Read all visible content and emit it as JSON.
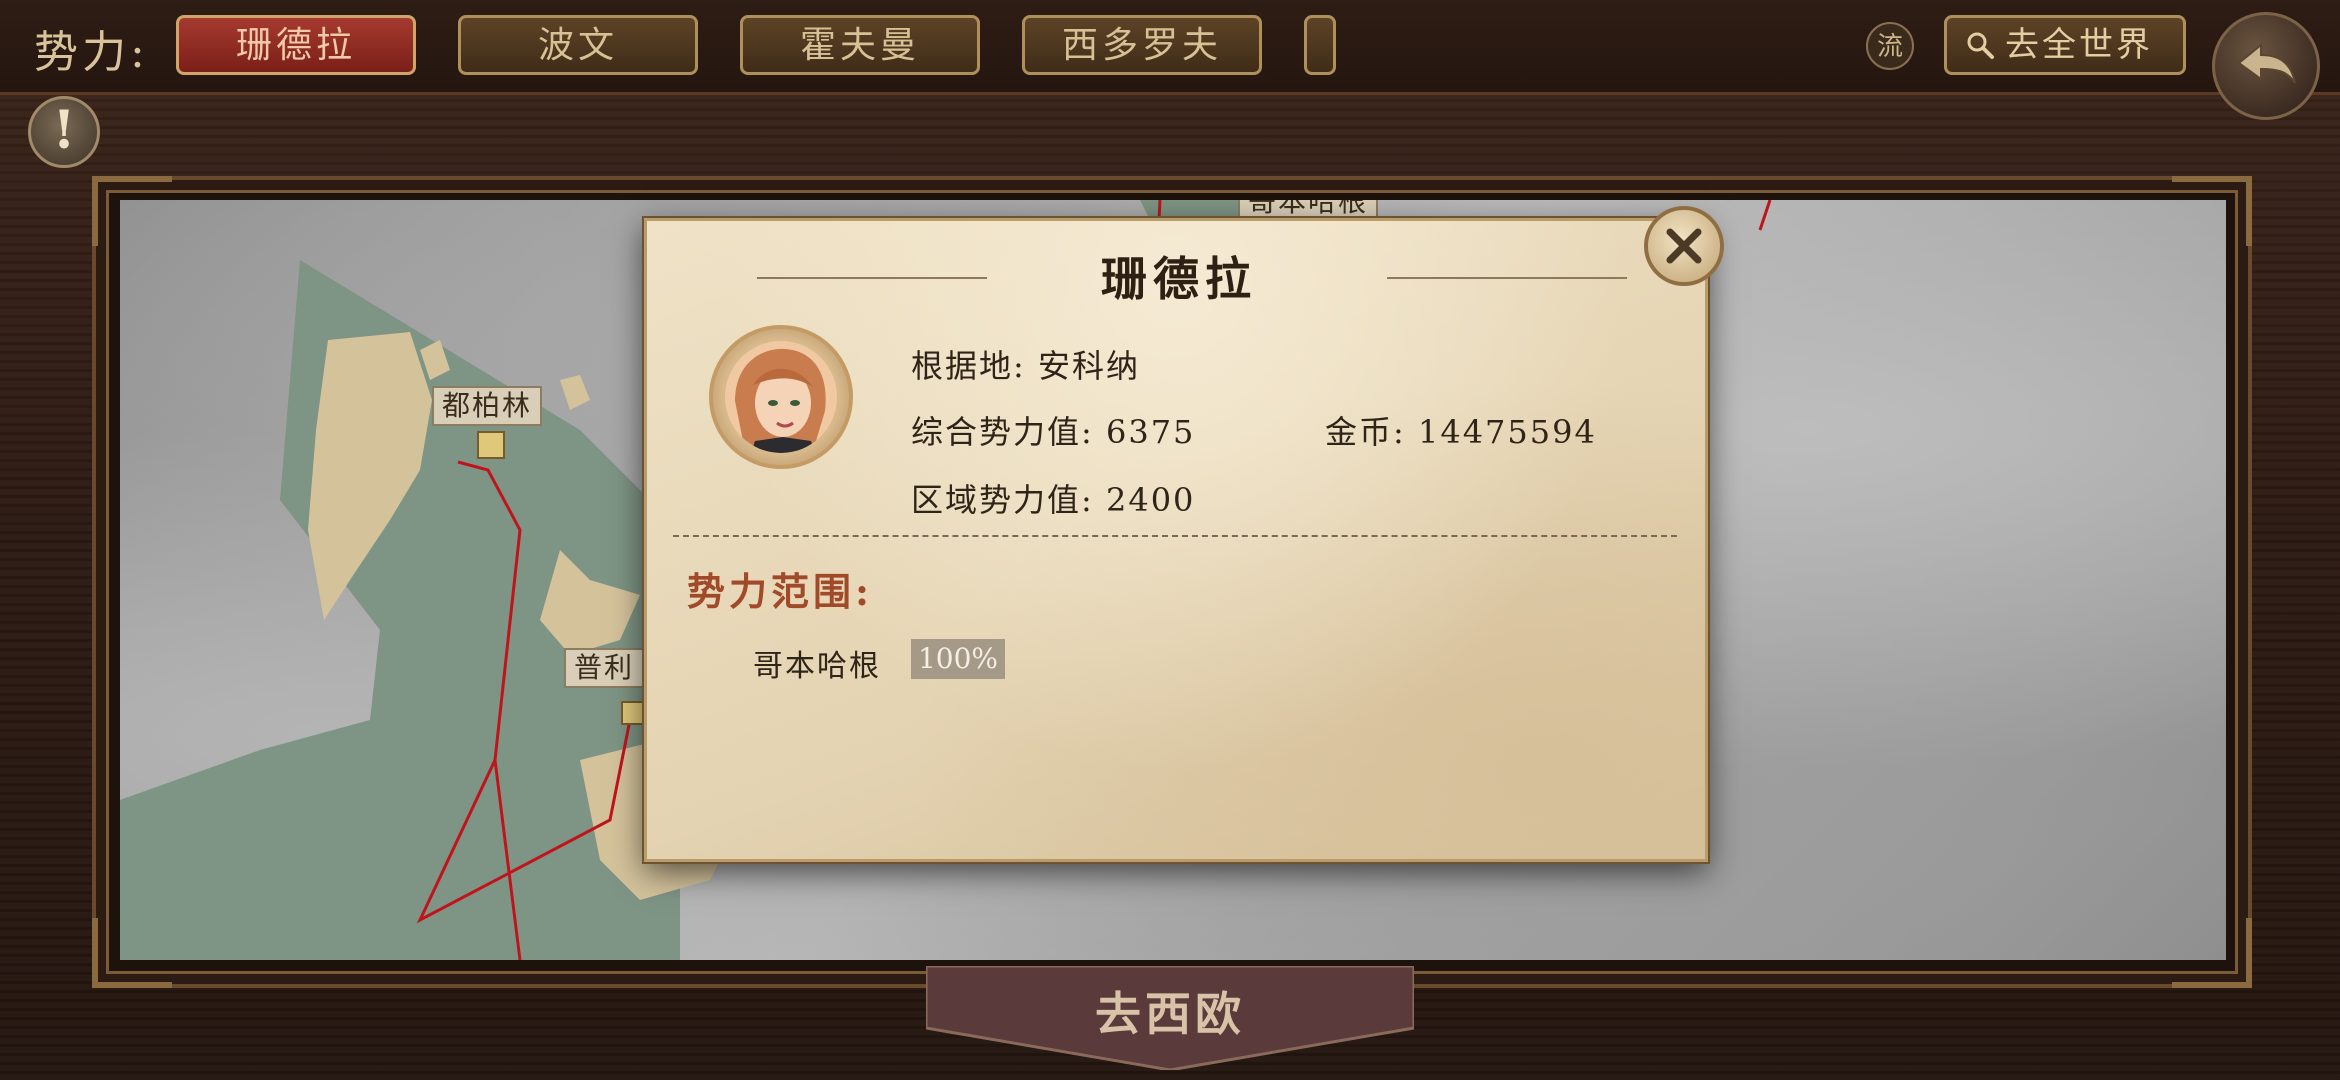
{
  "topbar": {
    "faction_label": "势力:",
    "tabs": [
      {
        "label": "珊德拉",
        "active": true
      },
      {
        "label": "波文",
        "active": false
      },
      {
        "label": "霍夫曼",
        "active": false
      },
      {
        "label": "西多罗夫",
        "active": false
      },
      {
        "label": "",
        "active": false
      }
    ],
    "flow_button": "流",
    "world_button": "去全世界"
  },
  "map": {
    "labels": [
      "都柏林",
      "普利",
      "哥本哈根"
    ]
  },
  "go_button": "去西欧",
  "dialog": {
    "title": "珊德拉",
    "base_label": "根据地:",
    "base_value": "安科纳",
    "total_power_label": "综合势力值:",
    "total_power_value": "6375",
    "gold_label": "金币:",
    "gold_value": "14475594",
    "region_power_label": "区域势力值:",
    "region_power_value": "2400",
    "range_title": "势力范围:",
    "range_items": [
      {
        "city": "哥本哈根",
        "percent": "100%"
      }
    ]
  },
  "colors": {
    "active_tab": "#8e2a22",
    "tab": "#4e3820",
    "parchment": "#e8d9bb",
    "border_red": "#c0141c"
  }
}
